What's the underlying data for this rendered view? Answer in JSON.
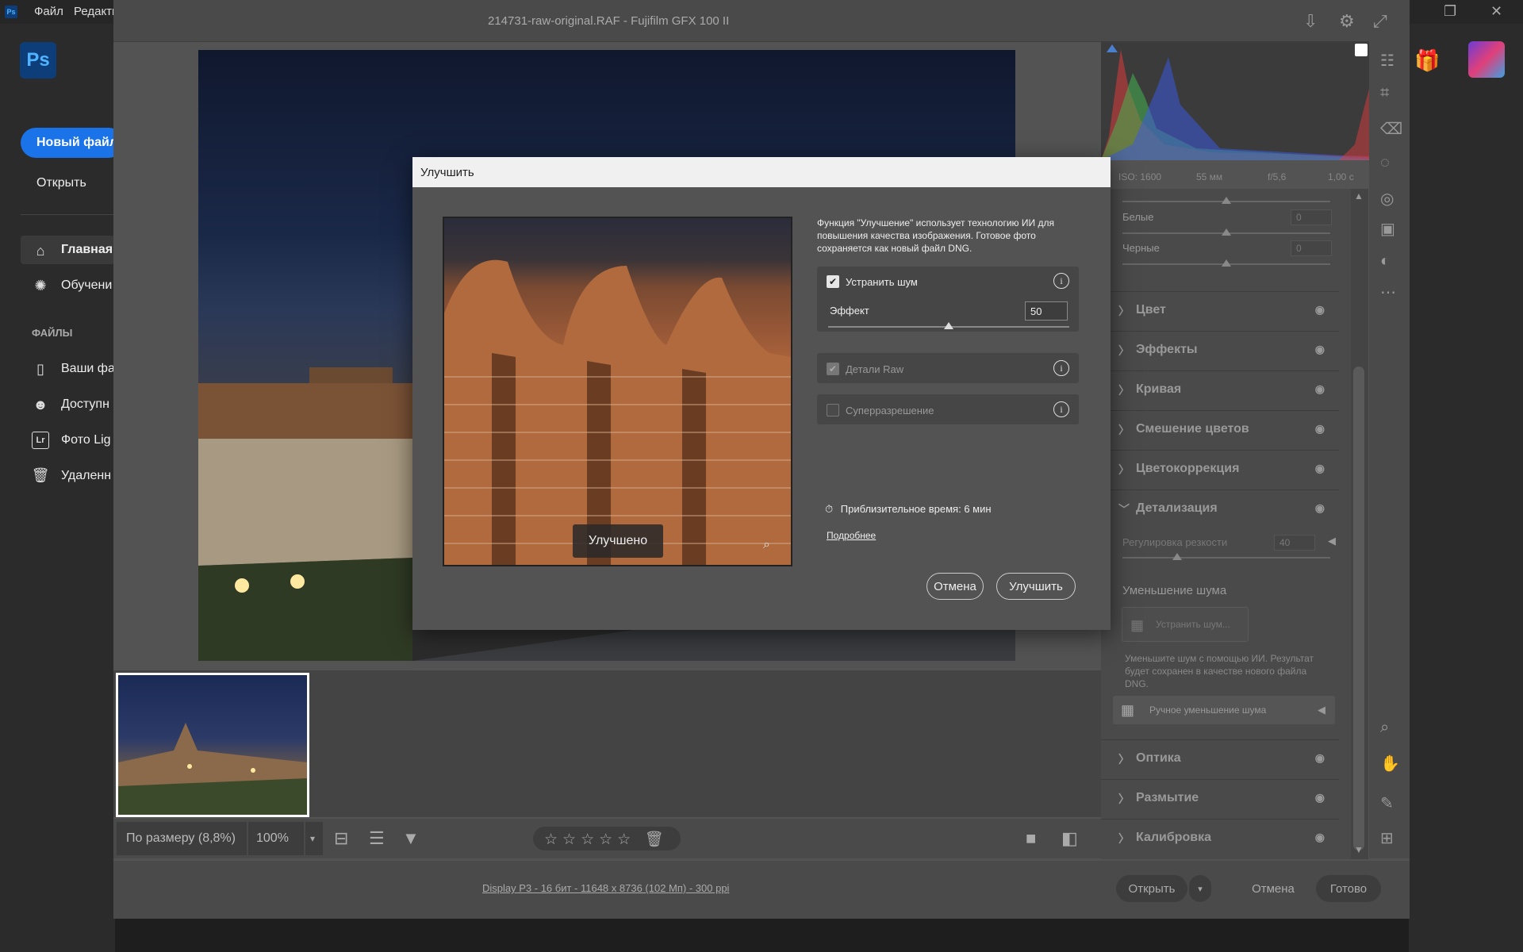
{
  "ps": {
    "logo": "Ps",
    "menu": [
      "Файл",
      "Редакти"
    ],
    "new_file": "Новый файл",
    "open": "Открыть",
    "home": "Главная",
    "learn": "Обучени",
    "files_section": "ФАЙЛЫ",
    "your_files": "Ваши фа",
    "shared": "Доступн",
    "lr_badge": "Lr",
    "lr_photos": "Фото Lig",
    "deleted": "Удаленн"
  },
  "acr": {
    "filename": "214731-raw-original.RAF  -  Fujifilm GFX 100 II",
    "meta": {
      "iso": "ISO: 1600",
      "focal": "55 мм",
      "aperture": "f/5,6",
      "shutter": "1,00 с"
    },
    "basic": {
      "whites_label": "Белые",
      "whites_val": "0",
      "blacks_label": "Черные",
      "blacks_val": "0"
    },
    "sections_top": [
      {
        "label": "Цвет"
      },
      {
        "label": "Эффекты"
      },
      {
        "label": "Кривая"
      },
      {
        "label": "Смешение цветов"
      },
      {
        "label": "Цветокоррекция"
      }
    ],
    "detail": {
      "title": "Детализация",
      "sharpen_label": "Регулировка резкости",
      "sharpen_val": "40",
      "nr_title": "Уменьшение шума",
      "nr_button": "Устранить шум...",
      "nr_desc": "Уменьшите шум с помощью ИИ. Результат будет сохранен в качестве нового файла DNG.",
      "manual_nr": "Ручное уменьшение шума"
    },
    "sections_bottom": [
      {
        "label": "Оптика"
      },
      {
        "label": "Размытие"
      },
      {
        "label": "Калибровка"
      }
    ],
    "zoom_fit": "По размеру (8,8%)",
    "zoom_pct": "100%",
    "stars": "☆☆☆☆☆",
    "footer_link": "Display P3 - 16 бит - 11648 x 8736 (102 Мп) - 300 ppi",
    "open_btn": "Открыть",
    "cancel_btn": "Отмена",
    "done_btn": "Готово"
  },
  "dialog": {
    "title": "Улучшить",
    "preview_label": "Улучшено",
    "description": "Функция \"Улучшение\" использует технологию ИИ для повышения качества изображения. Готовое фото сохраняется как новый файл DNG.",
    "denoise": {
      "label": "Устранить шум",
      "checked": true,
      "effect_label": "Эффект",
      "effect_value": "50",
      "effect_level": 0.5
    },
    "raw_details": {
      "label": "Детали Raw",
      "checked": true,
      "disabled": true
    },
    "super_res": {
      "label": "Суперразрешение",
      "checked": false,
      "disabled": true
    },
    "time": "Приблизительное время: 6 мин",
    "more": "Подробнее",
    "cancel": "Отмена",
    "enhance": "Улучшить"
  }
}
